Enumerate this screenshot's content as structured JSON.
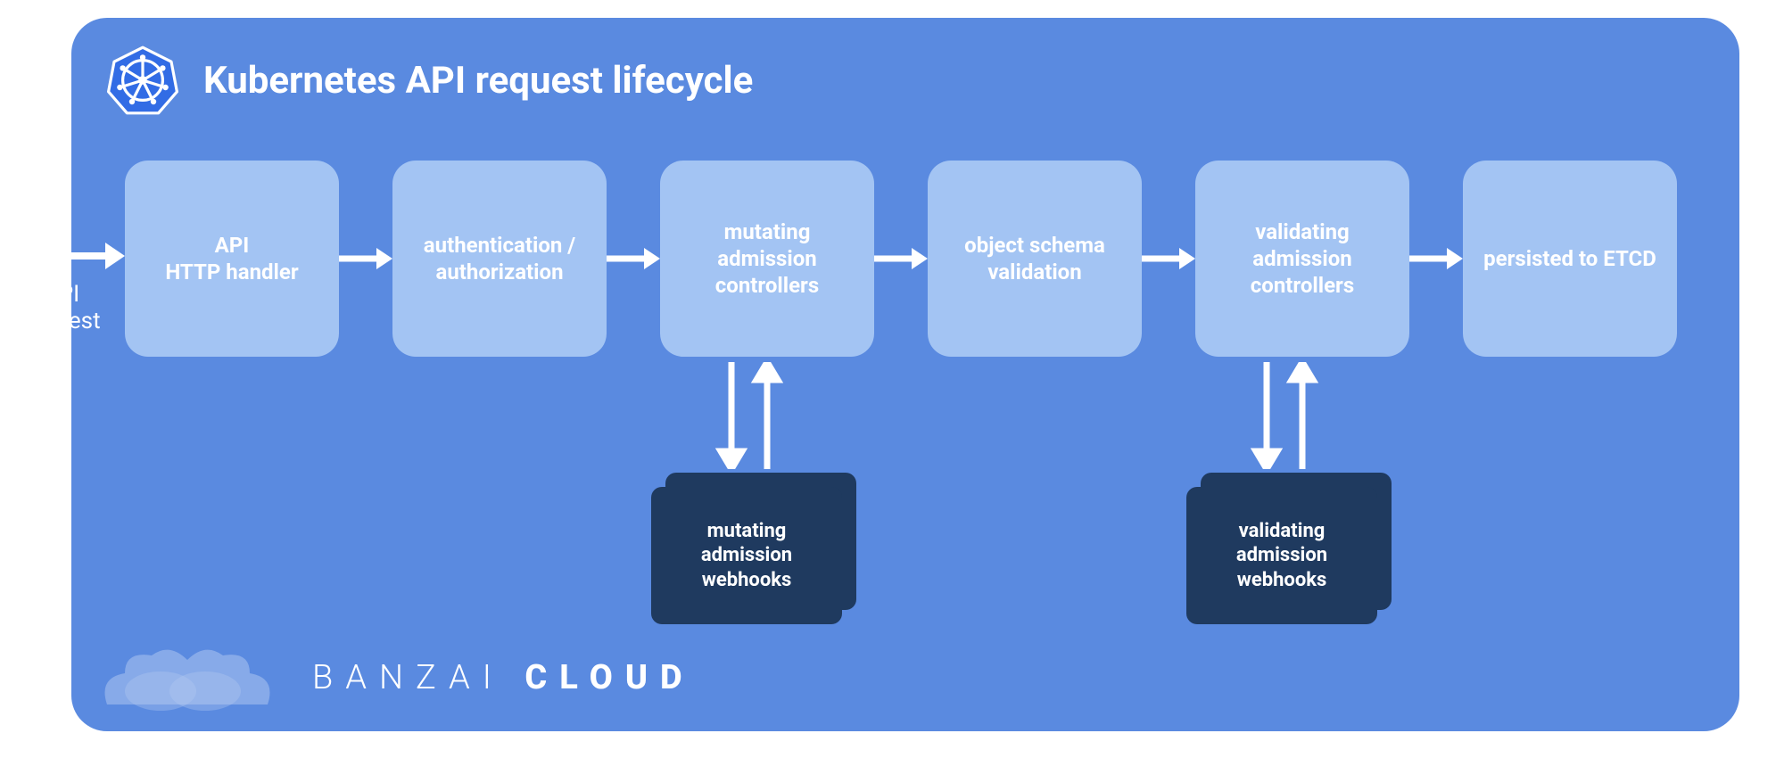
{
  "title": "Kubernetes API request lifecycle",
  "input_label": "API request",
  "stages": {
    "s0": "API\nHTTP handler",
    "s1": "authentication / authorization",
    "s2": "mutating admission controllers",
    "s3": "object schema validation",
    "s4": "validating admission controllers",
    "s5": "persisted to ETCD"
  },
  "webhooks": {
    "mutating": "mutating admission webhooks",
    "validating": "validating admission webhooks"
  },
  "brand": {
    "part1": "BANZAI",
    "part2": "CLOUD"
  },
  "colors": {
    "panel": "#5a8ae0",
    "box": "#a3c4f3",
    "webhook": "#1f3a5f",
    "arrow": "#ffffff"
  }
}
